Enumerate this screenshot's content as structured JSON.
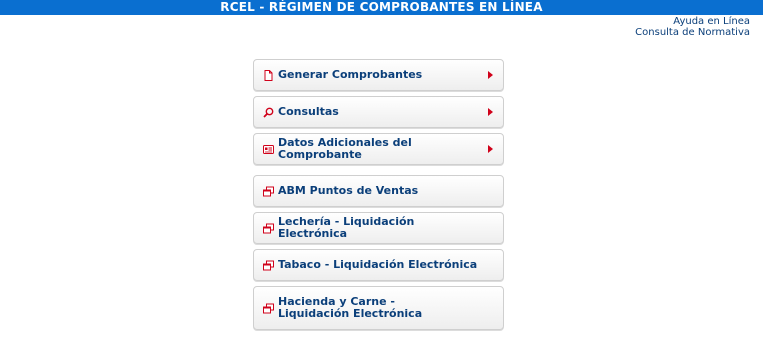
{
  "header": {
    "title": "RCEL - RÉGIMEN DE COMPROBANTES EN LÍNEA"
  },
  "top_links": {
    "help": "Ayuda en Línea",
    "regulations": "Consulta de Normativa"
  },
  "colors": {
    "header_bg": "#0a6fd0",
    "link_text": "#0b3f7a",
    "accent_red": "#d0021b"
  },
  "menu": {
    "items": [
      {
        "label": "Generar Comprobantes",
        "icon": "document-icon",
        "has_submenu": true
      },
      {
        "label": "Consultas",
        "icon": "search-icon",
        "has_submenu": true
      },
      {
        "label": "Datos Adicionales del Comprobante",
        "icon": "id-card-icon",
        "has_submenu": true
      },
      {
        "label": "ABM Puntos de Ventas",
        "icon": "external-window-icon",
        "has_submenu": false
      },
      {
        "label": "Lechería - Liquidación Electrónica",
        "icon": "external-window-icon",
        "has_submenu": false
      },
      {
        "label": "Tabaco - Liquidación Electrónica",
        "icon": "external-window-icon",
        "has_submenu": false
      },
      {
        "label": "Hacienda y Carne - Liquidación Electrónica",
        "icon": "external-window-icon",
        "has_submenu": false
      }
    ]
  }
}
